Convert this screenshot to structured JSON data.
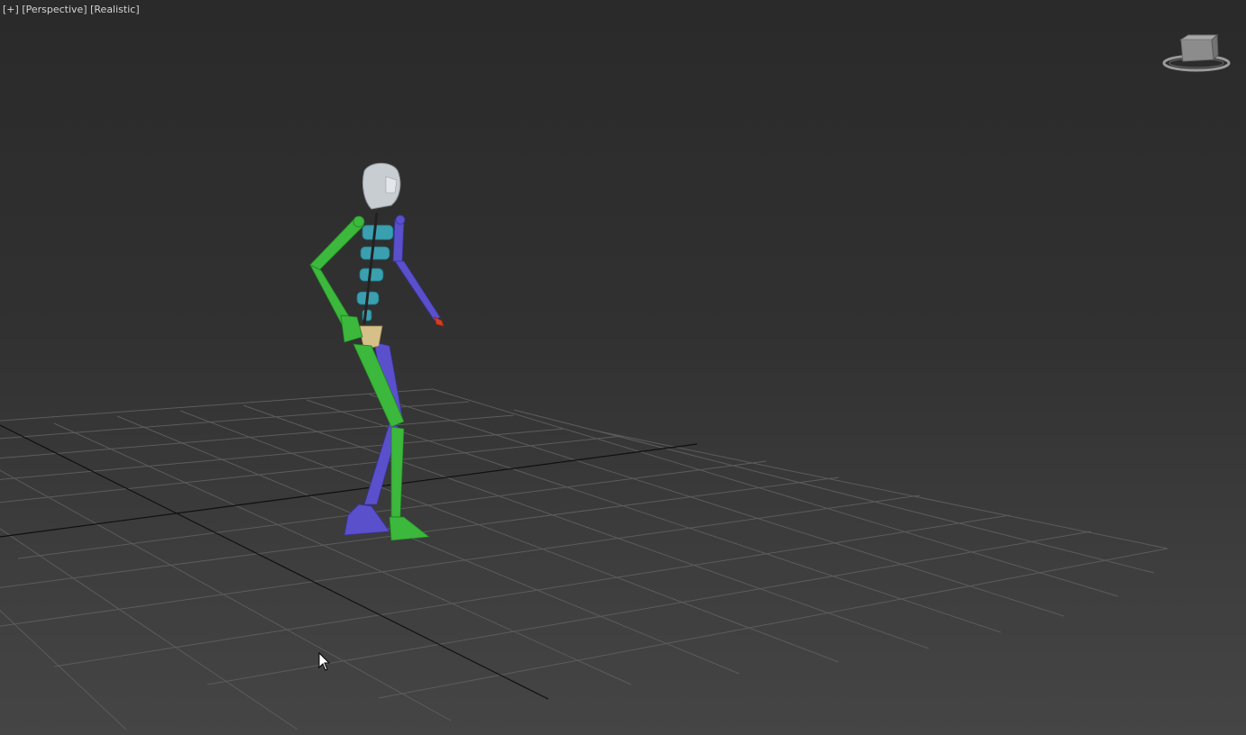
{
  "viewport": {
    "menu_label": "[+]",
    "view_label": "[Perspective]",
    "shading_label": "[Realistic]",
    "separator": " "
  },
  "viewcube": {
    "icon": "viewcube-icon",
    "face_label": "ViewCube"
  },
  "scene": {
    "grid": "home-grid",
    "figure": "biped-character",
    "colors": {
      "background_top": "#2a2a2a",
      "background_bottom": "#454545",
      "grid_line": "#5a5a5a",
      "grid_axis": "#111111",
      "left_limbs": "#3cb83c",
      "right_limbs": "#5a50cc",
      "spine": "#3aa0b0",
      "head": "#c8cdd2",
      "pelvis": "#d6c08a"
    }
  },
  "cursor": {
    "icon": "mouse-pointer-icon"
  }
}
